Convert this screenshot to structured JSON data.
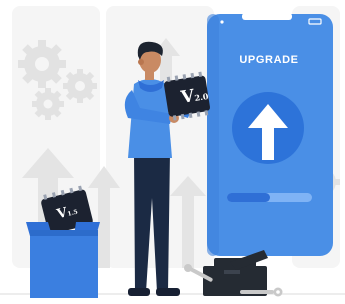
{
  "phone": {
    "title": "UPGRADE"
  },
  "chips": {
    "new_version": {
      "letter": "V",
      "number": "2.0"
    },
    "old_version": {
      "letter": "V",
      "number": "1.5"
    }
  },
  "colors": {
    "primary_blue": "#4a8fe6",
    "dark_blue": "#2f6fd6",
    "light_blue": "#7fb3f5",
    "navy": "#1b2a44",
    "gray_bg": "#ececec",
    "skin": "#c98a63",
    "hair": "#1d2430",
    "toolbox": "#252b33"
  },
  "icons": {
    "gears": "gear-icon",
    "arrows": "arrow-up-icon",
    "phone_arrow": "upload-arrow-icon",
    "wrench": "wrench-icon"
  }
}
